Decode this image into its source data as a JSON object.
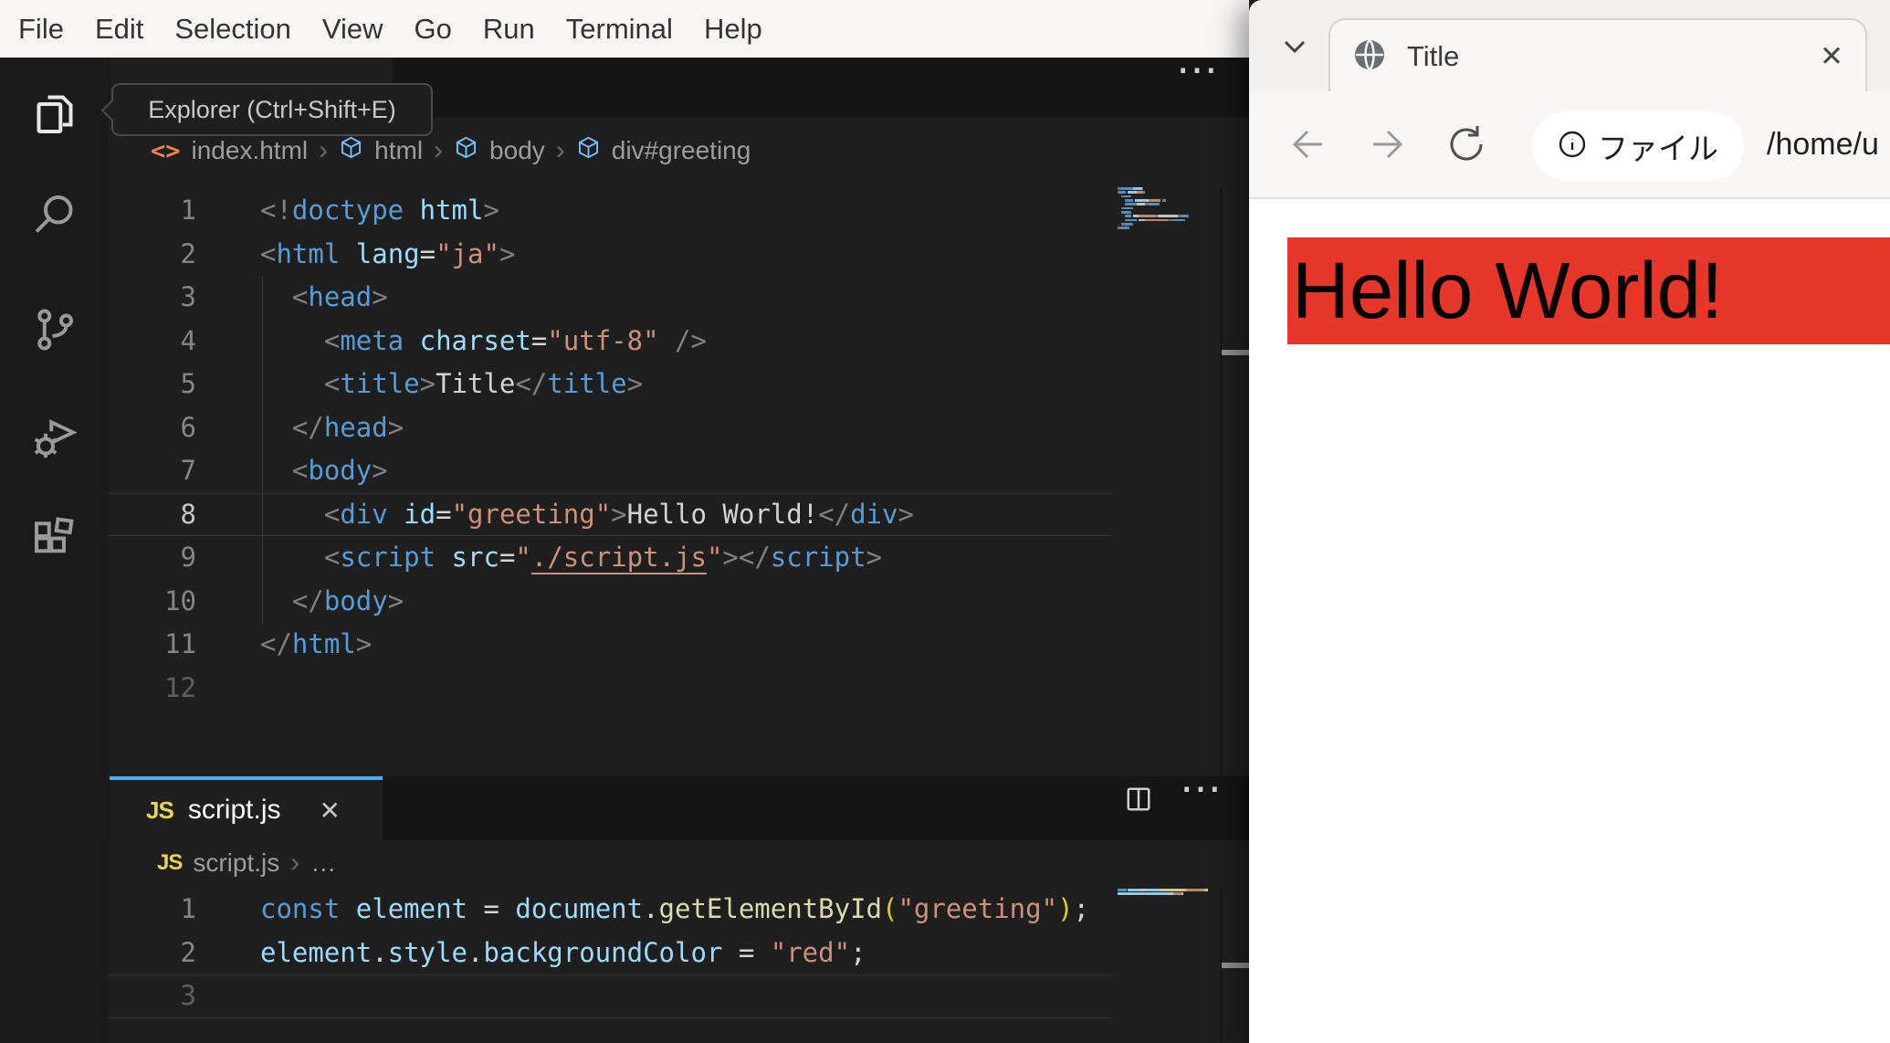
{
  "menu_bar": {
    "items": [
      "File",
      "Edit",
      "Selection",
      "View",
      "Go",
      "Run",
      "Terminal",
      "Help"
    ]
  },
  "activity_bar": {
    "tooltip": "Explorer (Ctrl+Shift+E)",
    "icons": [
      {
        "name": "explorer-icon",
        "active": true
      },
      {
        "name": "search-icon",
        "active": false
      },
      {
        "name": "source-control-icon",
        "active": false
      },
      {
        "name": "run-debug-icon",
        "active": false
      },
      {
        "name": "extensions-icon",
        "active": false
      }
    ]
  },
  "colors": {
    "tab_accent": "#4dabf5",
    "heading_bg": "#e7372b",
    "js_badge": "#e8d44d"
  },
  "html_editor": {
    "more_actions": "⋯",
    "breadcrumb": [
      "index.html",
      "html",
      "body",
      "div#greeting"
    ],
    "code": [
      {
        "n": "1",
        "t": [
          [
            "pn",
            "<!"
          ],
          [
            "tag",
            "doctype"
          ],
          [
            "attr",
            " html"
          ],
          [
            "pn",
            ">"
          ]
        ]
      },
      {
        "n": "2",
        "t": [
          [
            "pn",
            "<"
          ],
          [
            "tag",
            "html"
          ],
          [
            "txt",
            " "
          ],
          [
            "attr",
            "lang"
          ],
          [
            "txt",
            "="
          ],
          [
            "str",
            "\"ja\""
          ],
          [
            "pn",
            ">"
          ]
        ]
      },
      {
        "n": "3",
        "t": [
          [
            "txt",
            "  "
          ],
          [
            "pn",
            "<"
          ],
          [
            "tag",
            "head"
          ],
          [
            "pn",
            ">"
          ]
        ]
      },
      {
        "n": "4",
        "t": [
          [
            "txt",
            "    "
          ],
          [
            "pn",
            "<"
          ],
          [
            "tag",
            "meta"
          ],
          [
            "txt",
            " "
          ],
          [
            "attr",
            "charset"
          ],
          [
            "txt",
            "="
          ],
          [
            "str",
            "\"utf-8\""
          ],
          [
            "txt",
            " "
          ],
          [
            "pn",
            "/>"
          ]
        ]
      },
      {
        "n": "5",
        "t": [
          [
            "txt",
            "    "
          ],
          [
            "pn",
            "<"
          ],
          [
            "tag",
            "title"
          ],
          [
            "pn",
            ">"
          ],
          [
            "txt",
            "Title"
          ],
          [
            "pn",
            "</"
          ],
          [
            "tag",
            "title"
          ],
          [
            "pn",
            ">"
          ]
        ]
      },
      {
        "n": "6",
        "t": [
          [
            "txt",
            "  "
          ],
          [
            "pn",
            "</"
          ],
          [
            "tag",
            "head"
          ],
          [
            "pn",
            ">"
          ]
        ]
      },
      {
        "n": "7",
        "t": [
          [
            "txt",
            "  "
          ],
          [
            "pn",
            "<"
          ],
          [
            "tag",
            "body"
          ],
          [
            "pn",
            ">"
          ]
        ]
      },
      {
        "n": "8",
        "active": true,
        "t": [
          [
            "txt",
            "    "
          ],
          [
            "pn",
            "<"
          ],
          [
            "tag",
            "div"
          ],
          [
            "txt",
            " "
          ],
          [
            "attr",
            "id"
          ],
          [
            "txt",
            "="
          ],
          [
            "str",
            "\"greeting\""
          ],
          [
            "pn",
            ">"
          ],
          [
            "txt",
            "Hello World!"
          ],
          [
            "pn",
            "</"
          ],
          [
            "tag",
            "div"
          ],
          [
            "pn",
            ">"
          ]
        ]
      },
      {
        "n": "9",
        "t": [
          [
            "txt",
            "    "
          ],
          [
            "pn",
            "<"
          ],
          [
            "tag",
            "script"
          ],
          [
            "txt",
            " "
          ],
          [
            "attr",
            "src"
          ],
          [
            "txt",
            "="
          ],
          [
            "str",
            "\""
          ],
          [
            "u",
            "./script.js"
          ],
          [
            "str",
            "\""
          ],
          [
            "pn",
            "></"
          ],
          [
            "tag",
            "script"
          ],
          [
            "pn",
            ">"
          ]
        ]
      },
      {
        "n": "10",
        "t": [
          [
            "txt",
            "  "
          ],
          [
            "pn",
            "</"
          ],
          [
            "tag",
            "body"
          ],
          [
            "pn",
            ">"
          ]
        ]
      },
      {
        "n": "11",
        "t": [
          [
            "pn",
            "</"
          ],
          [
            "tag",
            "html"
          ],
          [
            "pn",
            ">"
          ]
        ]
      },
      {
        "n": "12",
        "dim": true,
        "t": []
      }
    ]
  },
  "js_editor": {
    "tab_label": "script.js",
    "tab_close": "✕",
    "js_badge": "JS",
    "more_actions": "⋯",
    "breadcrumb": [
      "script.js",
      "…"
    ],
    "code": [
      {
        "n": "1",
        "t": [
          [
            "tag",
            "const"
          ],
          [
            "txt",
            " "
          ],
          [
            "attr",
            "element"
          ],
          [
            "txt",
            " = "
          ],
          [
            "attr",
            "document"
          ],
          [
            "txt",
            "."
          ],
          [
            "fn",
            "getElementById"
          ],
          [
            "br",
            "("
          ],
          [
            "str",
            "\"greeting\""
          ],
          [
            "br",
            ")"
          ],
          [
            "txt",
            ";"
          ]
        ]
      },
      {
        "n": "2",
        "t": [
          [
            "attr",
            "element"
          ],
          [
            "txt",
            "."
          ],
          [
            "attr",
            "style"
          ],
          [
            "txt",
            "."
          ],
          [
            "attr",
            "backgroundColor"
          ],
          [
            "txt",
            " = "
          ],
          [
            "str",
            "\"red\""
          ],
          [
            "txt",
            ";"
          ]
        ]
      },
      {
        "n": "3",
        "active": true,
        "dim": true,
        "t": []
      }
    ]
  },
  "browser": {
    "tab_title": "Title",
    "tab_close": "✕",
    "chip_label": "ファイル",
    "url": "/home/u",
    "page_heading": "Hello World!"
  }
}
